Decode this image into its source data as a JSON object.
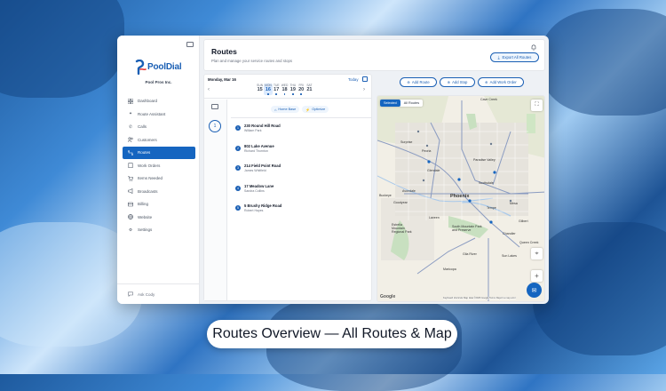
{
  "app": {
    "brand": "PoolDial",
    "org": "Pool Pros Inc."
  },
  "sidebar": {
    "items": [
      {
        "label": "Dashboard",
        "icon": "grid-icon",
        "active": false
      },
      {
        "label": "Route Assistant",
        "icon": "sparkle-icon",
        "active": false
      },
      {
        "label": "Calls",
        "icon": "phone-icon",
        "active": false
      },
      {
        "label": "Customers",
        "icon": "users-icon",
        "active": false
      },
      {
        "label": "Routes",
        "icon": "route-icon",
        "active": true
      },
      {
        "label": "Work Orders",
        "icon": "clipboard-icon",
        "active": false
      },
      {
        "label": "Items Needed",
        "icon": "cart-icon",
        "active": false
      },
      {
        "label": "Broadcasts",
        "icon": "megaphone-icon",
        "active": false
      },
      {
        "label": "Billing",
        "icon": "card-icon",
        "active": false
      },
      {
        "label": "Website",
        "icon": "globe-icon",
        "active": false
      },
      {
        "label": "Settings",
        "icon": "gear-icon",
        "active": false
      }
    ],
    "ask": "Ask Cody"
  },
  "header": {
    "title": "Routes",
    "subtitle": "Plan and manage your service routes and stops",
    "export_label": "Export All Routes"
  },
  "calendar": {
    "date_label": "Monday, Mar 16",
    "today_label": "Today",
    "days": [
      {
        "name": "SUN",
        "num": "15"
      },
      {
        "name": "MON",
        "num": "16"
      },
      {
        "name": "TUE",
        "num": "17"
      },
      {
        "name": "WED",
        "num": "18"
      },
      {
        "name": "THU",
        "num": "19"
      },
      {
        "name": "FRI",
        "num": "20"
      },
      {
        "name": "SAT",
        "num": "21"
      }
    ]
  },
  "tech": {
    "badge": "1"
  },
  "route": {
    "home_base": "Home Base",
    "optimize": "Optimize",
    "stops": [
      {
        "num": "1",
        "address": "230 Round Hill Road",
        "name": "William Park"
      },
      {
        "num": "2",
        "address": "802 Lake Avenue",
        "name": "Richard Thornton"
      },
      {
        "num": "3",
        "address": "214 Field Point Road",
        "name": "James Whitfield"
      },
      {
        "num": "4",
        "address": "17 Meadow Lane",
        "name": "Sandra Collins"
      },
      {
        "num": "5",
        "address": "5 Brushy Ridge Road",
        "name": "Robert Hayes"
      }
    ]
  },
  "actions": {
    "add_route": "Add Route",
    "add_stop": "Add Stop",
    "add_work_order": "Add Work Order"
  },
  "map": {
    "toggle_selected": "Selected",
    "toggle_all": "All Routes",
    "google": "Google",
    "attribution": "Keyboard shortcuts   Map data ©2026 Google   Terms   Report a map error",
    "cities": {
      "phoenix": "Phoenix",
      "glendale": "Glendale",
      "scottsdale": "Scottsdale",
      "tempe": "Tempe",
      "mesa": "Mesa",
      "gilbert": "Gilbert",
      "chandler": "Chandler",
      "peoria": "Peoria",
      "cave_creek": "Cave Creek",
      "paradise_valley": "Paradise Valley",
      "south_mountain": "South Mountain Park and Preserve",
      "estrella": "Estrella Mountain Regional Park",
      "maricopa": "Maricopa",
      "laveen": "Laveen",
      "avondale": "Avondale",
      "buckeye": "Buckeye",
      "goodyear": "Goodyear",
      "surprise": "Surprise",
      "sun_lakes": "Sun Lakes",
      "queen_creek": "Queen Creek",
      "gila_river": "Gila River"
    }
  },
  "caption": "Routes Overview — All Routes & Map"
}
